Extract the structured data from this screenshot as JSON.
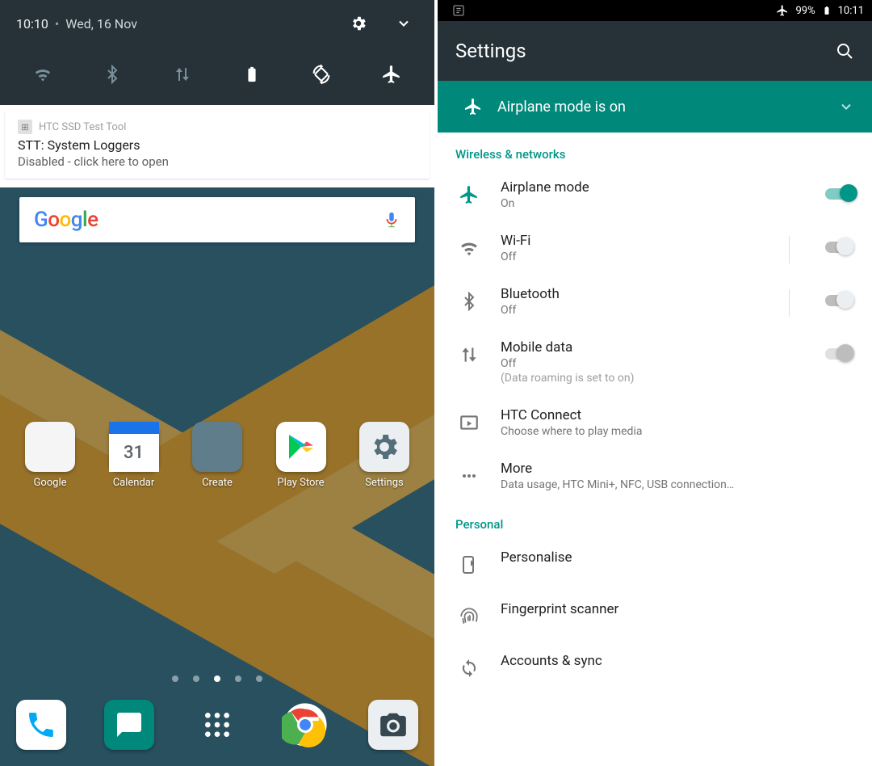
{
  "left": {
    "qs": {
      "time": "10:10",
      "date": "Wed, 16 Nov",
      "toggles": [
        "wifi",
        "bluetooth",
        "data",
        "battery",
        "rotate",
        "airplane"
      ]
    },
    "notification": {
      "app": "HTC SSD Test Tool",
      "title": "STT: System Loggers",
      "body": "Disabled - click here to open"
    },
    "search": {
      "logo": "Google"
    },
    "apps": [
      {
        "label": "Google"
      },
      {
        "label": "Calendar"
      },
      {
        "label": "Create"
      },
      {
        "label": "Play Store"
      },
      {
        "label": "Settings"
      }
    ],
    "hotseat": [
      "Phone",
      "Messages",
      "Apps",
      "Chrome",
      "Camera"
    ]
  },
  "right": {
    "status": {
      "battery": "99%",
      "time": "10:11"
    },
    "title": "Settings",
    "banner": "Airplane mode is on",
    "section1": "Wireless & networks",
    "items": [
      {
        "title": "Airplane mode",
        "sub": "On",
        "switch": "on"
      },
      {
        "title": "Wi-Fi",
        "sub": "Off",
        "switch": "off"
      },
      {
        "title": "Bluetooth",
        "sub": "Off",
        "switch": "off"
      },
      {
        "title": "Mobile data",
        "sub": "Off",
        "hint": "(Data roaming is set to on)",
        "switch": "disabled"
      },
      {
        "title": "HTC Connect",
        "sub": "Choose where to play media"
      },
      {
        "title": "More",
        "sub": "Data usage, HTC Mini+, NFC, USB connection…"
      }
    ],
    "section2": "Personal",
    "personal": [
      {
        "title": "Personalise"
      },
      {
        "title": "Fingerprint scanner"
      },
      {
        "title": "Accounts & sync"
      }
    ]
  }
}
